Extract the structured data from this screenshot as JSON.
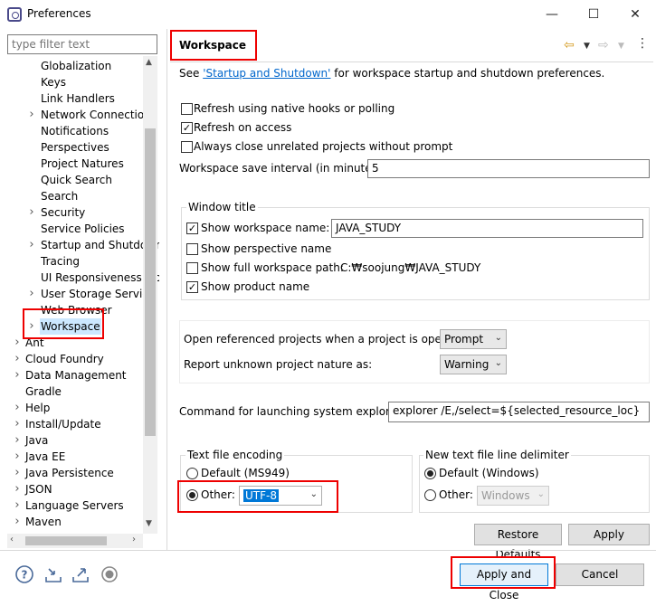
{
  "window": {
    "title": "Preferences",
    "minimize": "—",
    "maximize": "☐",
    "close": "✕"
  },
  "filter": {
    "placeholder": "type filter text"
  },
  "tree": {
    "items": [
      {
        "label": "Globalization",
        "expandable": false
      },
      {
        "label": "Keys",
        "expandable": false
      },
      {
        "label": "Link Handlers",
        "expandable": false
      },
      {
        "label": "Network Connections",
        "expandable": true
      },
      {
        "label": "Notifications",
        "expandable": false
      },
      {
        "label": "Perspectives",
        "expandable": false
      },
      {
        "label": "Project Natures",
        "expandable": false
      },
      {
        "label": "Quick Search",
        "expandable": false
      },
      {
        "label": "Search",
        "expandable": false
      },
      {
        "label": "Security",
        "expandable": true
      },
      {
        "label": "Service Policies",
        "expandable": false
      },
      {
        "label": "Startup and Shutdown",
        "expandable": true
      },
      {
        "label": "Tracing",
        "expandable": false
      },
      {
        "label": "UI Responsiveness Monitoring",
        "expandable": false
      },
      {
        "label": "User Storage Service",
        "expandable": true
      },
      {
        "label": "Web Browser",
        "expandable": false
      },
      {
        "label": "Workspace",
        "expandable": true,
        "selected": true
      }
    ],
    "top_items": [
      {
        "label": "Ant",
        "expandable": true
      },
      {
        "label": "Cloud Foundry",
        "expandable": true
      },
      {
        "label": "Data Management",
        "expandable": true
      },
      {
        "label": "Gradle",
        "expandable": false
      },
      {
        "label": "Help",
        "expandable": true
      },
      {
        "label": "Install/Update",
        "expandable": true
      },
      {
        "label": "Java",
        "expandable": true
      },
      {
        "label": "Java EE",
        "expandable": true
      },
      {
        "label": "Java Persistence",
        "expandable": true
      },
      {
        "label": "JSON",
        "expandable": true
      },
      {
        "label": "Language Servers",
        "expandable": true
      },
      {
        "label": "Maven",
        "expandable": true
      }
    ]
  },
  "page": {
    "title": "Workspace",
    "desc_prefix": "See ",
    "desc_link": "'Startup and Shutdown'",
    "desc_suffix": " for workspace startup and shutdown preferences.",
    "refresh_native": {
      "label": "Refresh using native hooks or polling",
      "checked": false
    },
    "refresh_access": {
      "label": "Refresh on access",
      "checked": true
    },
    "always_close": {
      "label": "Always close unrelated projects without prompt",
      "checked": false
    },
    "save_interval": {
      "label": "Workspace save interval (in minutes):",
      "value": "5"
    },
    "window_title": {
      "group_label": "Window title",
      "show_ws_name": {
        "label": "Show workspace name:",
        "checked": true,
        "value": "JAVA_STUDY"
      },
      "show_perspective": {
        "label": "Show perspective name",
        "checked": false
      },
      "show_full_path": {
        "label": "Show full workspace path:",
        "checked": false,
        "value": "C:₩soojung₩JAVA_STUDY"
      },
      "show_product": {
        "label": "Show product name",
        "checked": true
      }
    },
    "open_ref": {
      "label": "Open referenced projects when a project is opened:",
      "value": "Prompt"
    },
    "report_unknown": {
      "label": "Report unknown project nature as:",
      "value": "Warning"
    },
    "explorer_cmd": {
      "label": "Command for launching system explorer:",
      "value": "explorer /E,/select=${selected_resource_loc}"
    },
    "encoding": {
      "group_label": "Text file encoding",
      "default_label": "Default (MS949)",
      "other_label": "Other:",
      "other_value": "UTF-8",
      "selected": "other"
    },
    "line_delim": {
      "group_label": "New text file line delimiter",
      "default_label": "Default (Windows)",
      "other_label": "Other:",
      "other_value": "Windows",
      "selected": "default"
    },
    "restore_defaults": "Restore Defaults",
    "apply": "Apply"
  },
  "footer": {
    "apply_close": "Apply and Close",
    "cancel": "Cancel"
  },
  "icons": [
    "help-icon",
    "import-icon",
    "export-icon",
    "record-icon",
    "back-arrow-icon",
    "forward-arrow-icon",
    "view-menu-icon"
  ],
  "colors": {
    "highlight": "#e00000",
    "link": "#0066cc",
    "selection": "#cce8ff"
  }
}
